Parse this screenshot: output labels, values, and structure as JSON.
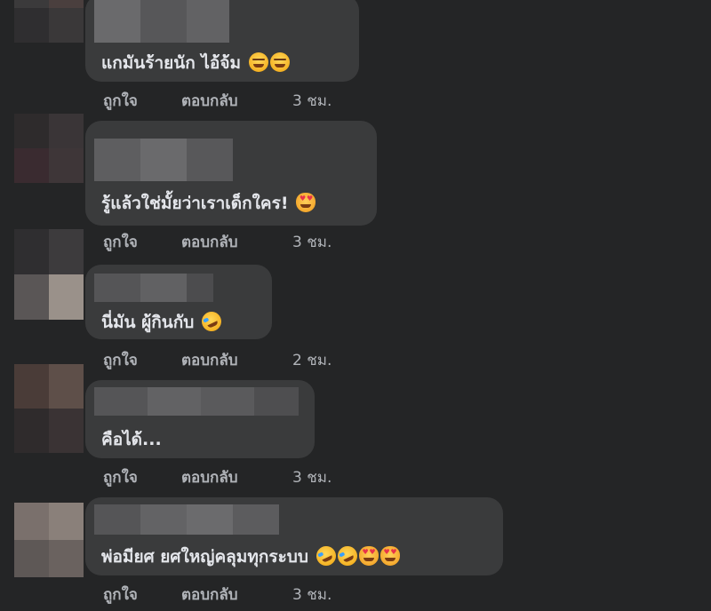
{
  "comments": [
    {
      "text": "แกมันร้ายนัก ไอ้จ้ม",
      "emojis": [
        "smirk-face-icon",
        "smirk-face-icon"
      ],
      "like": "ถูกใจ",
      "reply": "ตอบกลับ",
      "time": "3 ชม."
    },
    {
      "text": "รู้แล้วใช่มั้ยว่าเราเด็กใคร!",
      "emojis": [
        "heart-eyes-cat-icon"
      ],
      "like": "ถูกใจ",
      "reply": "ตอบกลับ",
      "time": "3 ชม."
    },
    {
      "text": "นี่มัน ผู้กินกับ",
      "emojis": [
        "rofl-face-icon"
      ],
      "like": "ถูกใจ",
      "reply": "ตอบกลับ",
      "time": "2 ชม."
    },
    {
      "text": "คือได้...",
      "emojis": [],
      "like": "ถูกใจ",
      "reply": "ตอบกลับ",
      "time": "3 ชม."
    },
    {
      "text": "พ่อมียศ ยศใหญ่คลุมทุกระบบ",
      "emojis": [
        "rofl-face-icon",
        "rofl-face-icon",
        "heart-eyes-cat-icon",
        "heart-eyes-cat-icon"
      ],
      "like": "ถูกใจ",
      "reply": "ตอบกลับ",
      "time": "3 ชม."
    }
  ],
  "colors": {
    "background": "#242526",
    "bubble": "#3a3b3c",
    "text": "#e4e6eb",
    "secondary_text": "#b0b3b8"
  }
}
